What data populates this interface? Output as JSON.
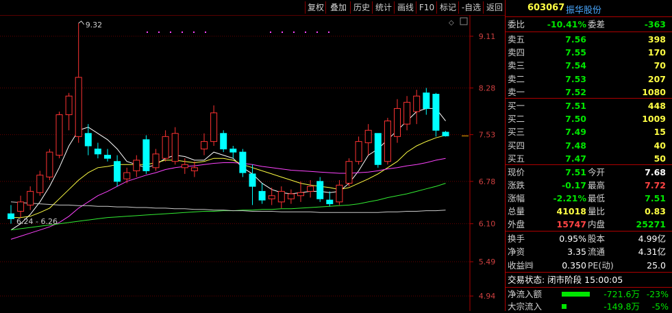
{
  "toolbar": {
    "buttons": [
      "复权",
      "叠加",
      "历史",
      "统计",
      "画线",
      "F10",
      "标记",
      "-自选",
      "返回"
    ]
  },
  "chart": {
    "price_labels": [
      "9.11",
      "8.28",
      "7.53",
      "6.78",
      "6.10",
      "5.49",
      "4.94"
    ],
    "annotation_high": "9.32",
    "annotation_low": "6.24 - 6.26",
    "small_marker": "◇"
  },
  "chart_data": {
    "type": "candlestick",
    "y_axis_ticks": [
      9.11,
      8.28,
      7.53,
      6.78,
      6.1,
      5.49,
      4.94
    ],
    "ylim": [
      4.7,
      9.45
    ],
    "candles": [
      {
        "o": 6.26,
        "h": 6.4,
        "l": 6.1,
        "c": 6.18
      },
      {
        "o": 6.3,
        "h": 6.55,
        "l": 6.2,
        "c": 6.45
      },
      {
        "o": 6.4,
        "h": 6.7,
        "l": 6.32,
        "c": 6.62
      },
      {
        "o": 6.6,
        "h": 6.95,
        "l": 6.55,
        "c": 6.88
      },
      {
        "o": 6.85,
        "h": 7.3,
        "l": 6.8,
        "c": 7.25
      },
      {
        "o": 7.2,
        "h": 7.9,
        "l": 7.15,
        "c": 7.85
      },
      {
        "o": 7.85,
        "h": 8.2,
        "l": 7.6,
        "c": 8.15
      },
      {
        "o": 7.5,
        "h": 9.32,
        "l": 7.4,
        "c": 8.45
      },
      {
        "o": 7.55,
        "h": 7.7,
        "l": 7.2,
        "c": 7.35
      },
      {
        "o": 7.3,
        "h": 7.4,
        "l": 7.15,
        "c": 7.22
      },
      {
        "o": 7.2,
        "h": 7.3,
        "l": 7.1,
        "c": 7.15
      },
      {
        "o": 7.1,
        "h": 7.2,
        "l": 6.7,
        "c": 6.78
      },
      {
        "o": 6.82,
        "h": 7.0,
        "l": 6.75,
        "c": 6.92
      },
      {
        "o": 6.95,
        "h": 7.2,
        "l": 6.85,
        "c": 7.12
      },
      {
        "o": 7.45,
        "h": 7.52,
        "l": 6.9,
        "c": 6.95
      },
      {
        "o": 7.0,
        "h": 7.3,
        "l": 6.95,
        "c": 7.22
      },
      {
        "o": 7.15,
        "h": 7.6,
        "l": 7.1,
        "c": 7.5
      },
      {
        "o": 7.1,
        "h": 7.65,
        "l": 7.05,
        "c": 7.55
      },
      {
        "o": 7.0,
        "h": 7.15,
        "l": 6.9,
        "c": 7.05
      },
      {
        "o": 6.95,
        "h": 7.1,
        "l": 6.85,
        "c": 7.0
      },
      {
        "o": 7.3,
        "h": 7.55,
        "l": 7.2,
        "c": 7.42
      },
      {
        "o": 7.42,
        "h": 8.0,
        "l": 7.35,
        "c": 7.88
      },
      {
        "o": 7.55,
        "h": 7.6,
        "l": 7.25,
        "c": 7.3
      },
      {
        "o": 7.3,
        "h": 7.35,
        "l": 7.15,
        "c": 7.25
      },
      {
        "o": 7.25,
        "h": 7.3,
        "l": 6.85,
        "c": 6.92
      },
      {
        "o": 6.9,
        "h": 7.05,
        "l": 6.4,
        "c": 6.7
      },
      {
        "o": 6.62,
        "h": 6.75,
        "l": 6.42,
        "c": 6.48
      },
      {
        "o": 6.5,
        "h": 6.68,
        "l": 6.4,
        "c": 6.55
      },
      {
        "o": 6.45,
        "h": 6.7,
        "l": 6.35,
        "c": 6.62
      },
      {
        "o": 6.5,
        "h": 6.65,
        "l": 6.42,
        "c": 6.58
      },
      {
        "o": 6.55,
        "h": 6.78,
        "l": 6.45,
        "c": 6.6
      },
      {
        "o": 6.62,
        "h": 6.8,
        "l": 6.52,
        "c": 6.7
      },
      {
        "o": 6.78,
        "h": 6.85,
        "l": 6.45,
        "c": 6.5
      },
      {
        "o": 6.48,
        "h": 6.62,
        "l": 6.38,
        "c": 6.42
      },
      {
        "o": 6.45,
        "h": 6.8,
        "l": 6.4,
        "c": 6.72
      },
      {
        "o": 6.75,
        "h": 7.15,
        "l": 6.7,
        "c": 7.1
      },
      {
        "o": 7.1,
        "h": 7.5,
        "l": 7.05,
        "c": 7.42
      },
      {
        "o": 7.4,
        "h": 7.7,
        "l": 7.2,
        "c": 7.6
      },
      {
        "o": 7.55,
        "h": 7.55,
        "l": 7.0,
        "c": 7.05
      },
      {
        "o": 7.1,
        "h": 7.8,
        "l": 7.05,
        "c": 7.75
      },
      {
        "o": 7.5,
        "h": 8.1,
        "l": 7.4,
        "c": 7.95
      },
      {
        "o": 7.7,
        "h": 8.15,
        "l": 7.6,
        "c": 8.05
      },
      {
        "o": 7.9,
        "h": 8.25,
        "l": 7.7,
        "c": 8.15
      },
      {
        "o": 8.2,
        "h": 8.28,
        "l": 7.85,
        "c": 7.95
      },
      {
        "o": 8.18,
        "h": 8.2,
        "l": 7.5,
        "c": 7.6
      },
      {
        "o": 7.57,
        "h": 7.59,
        "l": 7.5,
        "c": 7.51
      }
    ],
    "ma_lines": [
      {
        "color": "#ffffff",
        "values": [
          6.0,
          6.1,
          6.25,
          6.45,
          6.7,
          7.0,
          7.35,
          7.6,
          7.65,
          7.55,
          7.45,
          7.3,
          7.1,
          7.05,
          7.0,
          7.05,
          7.15,
          7.2,
          7.18,
          7.12,
          7.12,
          7.25,
          7.2,
          7.15,
          7.0,
          6.9,
          6.75,
          6.65,
          6.6,
          6.58,
          6.6,
          6.62,
          6.62,
          6.6,
          6.62,
          6.75,
          6.95,
          7.2,
          7.3,
          7.45,
          7.6,
          7.75,
          7.9,
          7.95,
          7.95,
          7.75
        ]
      },
      {
        "color": "#ffff44",
        "values": [
          6.2,
          6.2,
          6.22,
          6.28,
          6.35,
          6.5,
          6.65,
          6.8,
          6.92,
          7.0,
          7.02,
          7.05,
          7.05,
          7.05,
          7.05,
          7.08,
          7.12,
          7.12,
          7.1,
          7.08,
          7.1,
          7.15,
          7.15,
          7.12,
          7.05,
          7.0,
          6.95,
          6.9,
          6.85,
          6.8,
          6.75,
          6.72,
          6.7,
          6.68,
          6.65,
          6.68,
          6.75,
          6.82,
          6.9,
          7.0,
          7.1,
          7.25,
          7.35,
          7.42,
          7.48,
          7.52
        ]
      },
      {
        "color": "#ff44ff",
        "values": [
          5.85,
          5.9,
          5.95,
          6.0,
          6.05,
          6.12,
          6.22,
          6.35,
          6.45,
          6.55,
          6.62,
          6.7,
          6.78,
          6.83,
          6.88,
          6.92,
          6.97,
          7.0,
          7.02,
          7.03,
          7.05,
          7.07,
          7.08,
          7.08,
          7.07,
          7.05,
          7.02,
          7.0,
          6.98,
          6.96,
          6.95,
          6.94,
          6.93,
          6.92,
          6.91,
          6.91,
          6.92,
          6.93,
          6.95,
          6.98,
          7.0,
          7.03,
          7.05,
          7.08,
          7.12,
          7.15
        ]
      },
      {
        "color": "#33ee33",
        "values": [
          6.0,
          6.02,
          6.04,
          6.06,
          6.08,
          6.1,
          6.12,
          6.14,
          6.16,
          6.18,
          6.2,
          6.21,
          6.22,
          6.23,
          6.24,
          6.25,
          6.26,
          6.27,
          6.28,
          6.29,
          6.3,
          6.3,
          6.31,
          6.31,
          6.32,
          6.32,
          6.33,
          6.33,
          6.34,
          6.34,
          6.35,
          6.36,
          6.37,
          6.38,
          6.39,
          6.4,
          6.42,
          6.45,
          6.48,
          6.52,
          6.55,
          6.58,
          6.62,
          6.66,
          6.7,
          6.75
        ]
      },
      {
        "color": "#cccccc",
        "values": [
          6.45,
          6.44,
          6.43,
          6.42,
          6.41,
          6.4,
          6.4,
          6.39,
          6.39,
          6.38,
          6.38,
          6.37,
          6.37,
          6.36,
          6.36,
          6.35,
          6.35,
          6.34,
          6.34,
          6.33,
          6.33,
          6.32,
          6.32,
          6.31,
          6.31,
          6.3,
          6.3,
          6.3,
          6.29,
          6.29,
          6.29,
          6.29,
          6.28,
          6.28,
          6.28,
          6.28,
          6.28,
          6.28,
          6.28,
          6.29,
          6.29,
          6.3,
          6.3,
          6.31,
          6.31,
          6.32
        ]
      }
    ]
  },
  "quote": {
    "code": "603067",
    "name": "振华股份",
    "weibi_label": "委比",
    "weibi_value": "-10.41%",
    "weicha_label": "委差",
    "weicha_value": "-363",
    "asks": [
      {
        "label": "卖五",
        "price": "7.56",
        "vol": "398"
      },
      {
        "label": "卖四",
        "price": "7.55",
        "vol": "170"
      },
      {
        "label": "卖三",
        "price": "7.54",
        "vol": "70"
      },
      {
        "label": "卖二",
        "price": "7.53",
        "vol": "207"
      },
      {
        "label": "卖一",
        "price": "7.52",
        "vol": "1080"
      }
    ],
    "bids": [
      {
        "label": "买一",
        "price": "7.51",
        "vol": "448"
      },
      {
        "label": "买二",
        "price": "7.50",
        "vol": "1009"
      },
      {
        "label": "买三",
        "price": "7.49",
        "vol": "15"
      },
      {
        "label": "买四",
        "price": "7.48",
        "vol": "40"
      },
      {
        "label": "买五",
        "price": "7.47",
        "vol": "50"
      }
    ],
    "stats": [
      {
        "l1": "现价",
        "v1": "7.51",
        "c1": "green",
        "l2": "今开",
        "v2": "7.68",
        "c2": "white"
      },
      {
        "l1": "涨跌",
        "v1": "-0.17",
        "c1": "green",
        "l2": "最高",
        "v2": "7.72",
        "c2": "red"
      },
      {
        "l1": "涨幅",
        "v1": "-2.21%",
        "c1": "green",
        "l2": "最低",
        "v2": "7.51",
        "c2": "green"
      },
      {
        "l1": "总量",
        "v1": "41018",
        "c1": "yellow",
        "l2": "量比",
        "v2": "0.83",
        "c2": "yellow"
      },
      {
        "l1": "外盘",
        "v1": "15747",
        "c1": "red",
        "l2": "内盘",
        "v2": "25271",
        "c2": "green"
      }
    ],
    "fin": [
      {
        "l1": "换手",
        "v1": "0.95%",
        "l2": "股本",
        "v2": "4.99亿"
      },
      {
        "l1": "净资",
        "v1": "3.35",
        "l2": "流通",
        "v2": "4.31亿"
      },
      {
        "l1": "收益㈣",
        "v1": "0.350",
        "l2": "PE(动)",
        "v2": "25.0"
      }
    ],
    "trade_status": "交易状态: 闭市阶段 15:00:05",
    "flows": [
      {
        "label": "净流入额",
        "bar": 0.9,
        "value": "-721.6万",
        "pct": "-23%"
      },
      {
        "label": "大宗流入",
        "bar": 0.15,
        "value": "-149.8万",
        "pct": "-5%"
      }
    ]
  }
}
